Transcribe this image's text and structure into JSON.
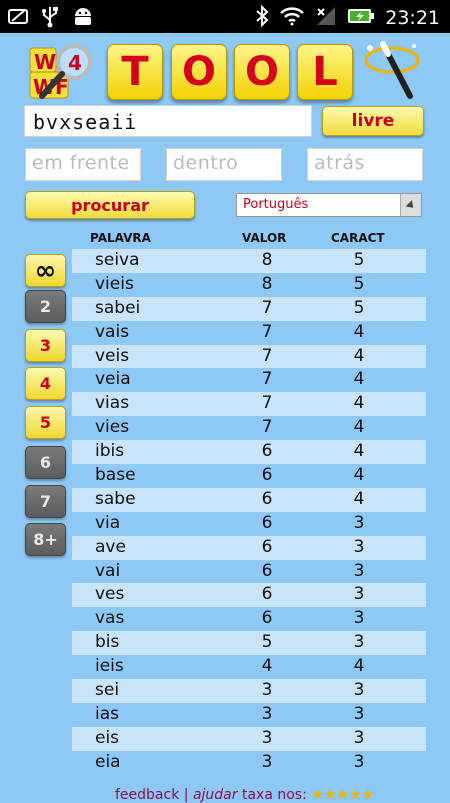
{
  "status_bar": {
    "time": "23:21",
    "icons": [
      "screenshot-icon",
      "usb-icon",
      "android-icon",
      "bluetooth-icon",
      "wifi-icon",
      "signal-icon",
      "battery-charging-icon"
    ]
  },
  "header": {
    "logo_text_top": "W",
    "logo_text_bottom": "WF",
    "logo_number": "4",
    "title_letters": [
      "T",
      "O",
      "O",
      "L"
    ]
  },
  "search": {
    "letters_value": "bvxseaii",
    "free_button": "livre",
    "front_placeholder": "em frente",
    "inside_placeholder": "dentro",
    "back_placeholder": "atrás",
    "search_button": "procurar",
    "language": "Português"
  },
  "filters": [
    "∞",
    "2",
    "3",
    "4",
    "5",
    "6",
    "7",
    "8+"
  ],
  "filter_state": [
    "on",
    "off",
    "on",
    "on",
    "on",
    "off",
    "off",
    "off"
  ],
  "table": {
    "headers": [
      "PALAVRA",
      "VALOR",
      "CARACT"
    ],
    "rows": [
      [
        "seiva",
        "8",
        "5"
      ],
      [
        "vieis",
        "8",
        "5"
      ],
      [
        "sabei",
        "7",
        "5"
      ],
      [
        "vais",
        "7",
        "4"
      ],
      [
        "veis",
        "7",
        "4"
      ],
      [
        "veia",
        "7",
        "4"
      ],
      [
        "vias",
        "7",
        "4"
      ],
      [
        "vies",
        "7",
        "4"
      ],
      [
        "ibis",
        "6",
        "4"
      ],
      [
        "base",
        "6",
        "4"
      ],
      [
        "sabe",
        "6",
        "4"
      ],
      [
        "via",
        "6",
        "3"
      ],
      [
        "ave",
        "6",
        "3"
      ],
      [
        "vai",
        "6",
        "3"
      ],
      [
        "ves",
        "6",
        "3"
      ],
      [
        "vas",
        "6",
        "3"
      ],
      [
        "bis",
        "5",
        "3"
      ],
      [
        "ieis",
        "4",
        "4"
      ],
      [
        "sei",
        "3",
        "3"
      ],
      [
        "ias",
        "3",
        "3"
      ],
      [
        "eis",
        "3",
        "3"
      ],
      [
        "eia",
        "3",
        "3"
      ]
    ]
  },
  "footer": {
    "feedback": "feedback",
    "separator": "|",
    "help": "ajudar",
    "rate": "taxa nos:",
    "stars": "★★★★★"
  },
  "colors": {
    "background": "#8ec8f5",
    "accent_red": "#c8001e",
    "button_yellow": "#f2dc3c",
    "row_stripe": "#c9e3f8"
  }
}
